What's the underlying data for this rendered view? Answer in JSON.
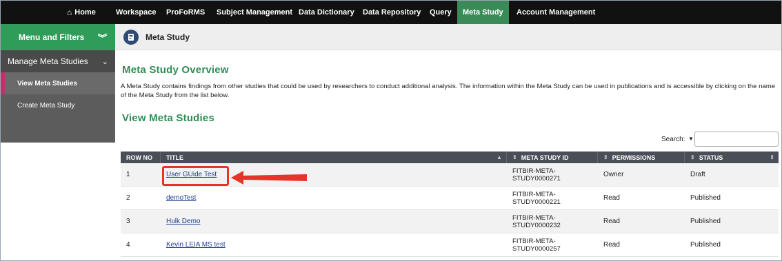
{
  "topnav": {
    "home": "Home",
    "items": [
      "Workspace",
      "ProFoRMS",
      "Subject Management",
      "Data Dictionary",
      "Data Repository",
      "Query",
      "Meta Study",
      "Account Management"
    ],
    "active": "Meta Study"
  },
  "sidebar": {
    "header": "Menu and Filters",
    "group": "Manage Meta Studies",
    "items": [
      "View Meta Studies",
      "Create Meta Study"
    ],
    "active": "View Meta Studies"
  },
  "page": {
    "head_title": "Meta Study",
    "overview_title": "Meta Study Overview",
    "description": "A Meta Study contains findings from other studies that could be used by researchers to conduct additional analysis. The information within the Meta Study can be used in publications and is accessible by clicking on the name of the Meta Study from the list below.",
    "view_title": "View Meta Studies",
    "search_label": "Search:",
    "search_value": ""
  },
  "table": {
    "headers": [
      "ROW NO",
      "TITLE",
      "META STUDY ID",
      "PERMISSIONS",
      "STATUS"
    ],
    "rows": [
      {
        "row_no": "1",
        "title": "User GUide Test",
        "id_line1": "FITBIR-META-",
        "id_line2": "STUDY0000271",
        "permissions": "Owner",
        "status": "Draft"
      },
      {
        "row_no": "2",
        "title": "demoTest",
        "id_line1": "FITBIR-META-",
        "id_line2": "STUDY0000221",
        "permissions": "Read",
        "status": "Published"
      },
      {
        "row_no": "3",
        "title": "Hulk Demo",
        "id_line1": "FITBIR-META-",
        "id_line2": "STUDY0000232",
        "permissions": "Read",
        "status": "Published"
      },
      {
        "row_no": "4",
        "title": "Kevin LEIA MS test",
        "id_line1": "FITBIR-META-",
        "id_line2": "STUDY0000257",
        "permissions": "Read",
        "status": "Published"
      }
    ]
  },
  "icons": {
    "home": "house-icon",
    "page": "document-icon",
    "collapse": "double-chevron-icon",
    "group": "chevron-down-icon",
    "sort": "sort-icon"
  },
  "colors": {
    "accent_green": "#2f9c5a",
    "heading_green": "#2f8c55",
    "annotation_red": "#e5342a",
    "active_marker": "#c0336a"
  }
}
